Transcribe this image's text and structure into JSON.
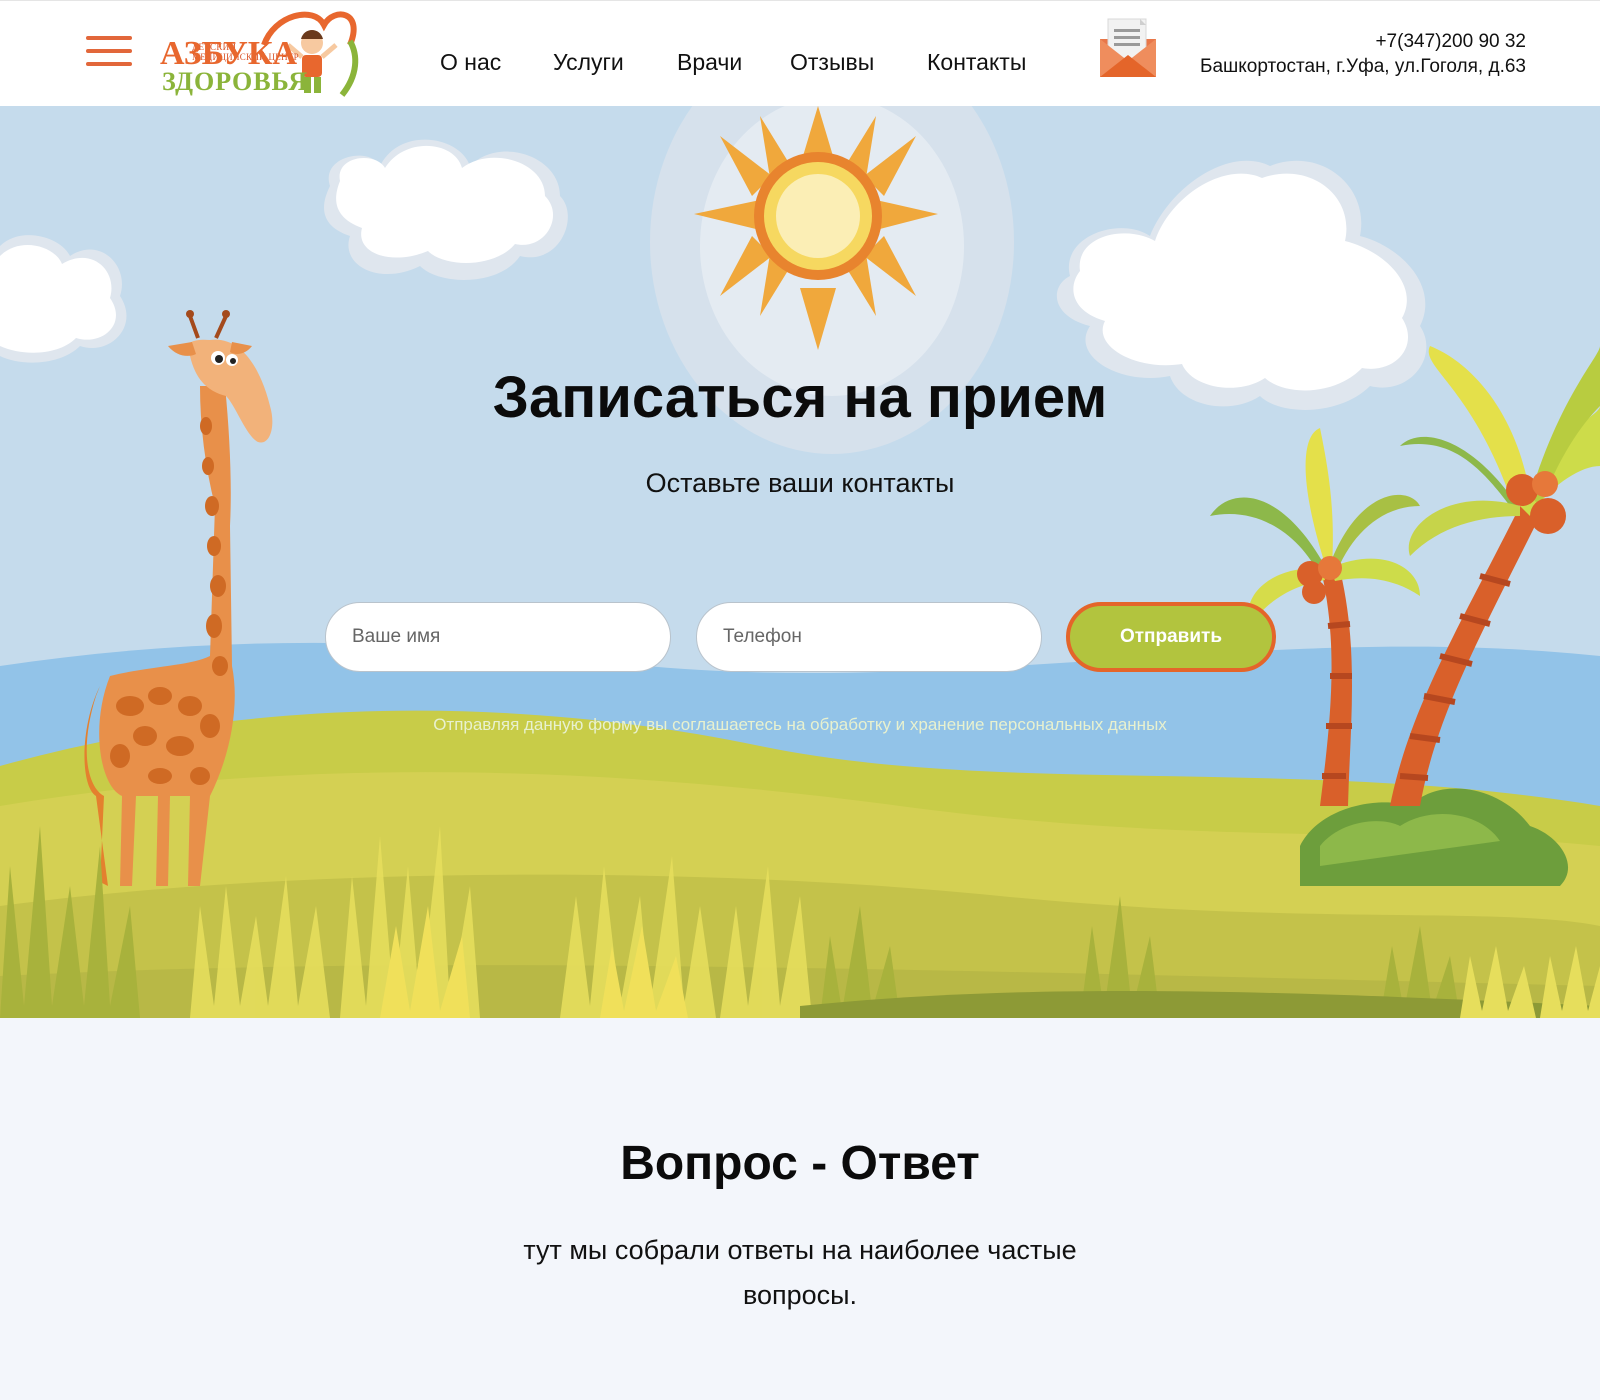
{
  "header": {
    "logo": {
      "line1": "ДЕТСКИЙ",
      "line2": "МЕДИЦИНСКИЙ ЦЕНТР",
      "word1": "АЗБУКА",
      "word2": "ЗДОРОВЬЯ"
    },
    "nav": [
      {
        "label": "О нас"
      },
      {
        "label": "Услуги"
      },
      {
        "label": "Врачи"
      },
      {
        "label": "Отзывы"
      },
      {
        "label": "Контакты"
      }
    ],
    "phone": "+7(347)200 90 32",
    "address": "Башкортостан, г.Уфа, ул.Гоголя, д.63"
  },
  "hero": {
    "title": "Записаться на прием",
    "subtitle": "Оставьте ваши контакты",
    "name_placeholder": "Ваше имя",
    "phone_placeholder": "Телефон",
    "submit_label": "Отправить",
    "consent": "Отправляя данную форму вы соглашаетесь на обработку и хранение персональных данных"
  },
  "faq": {
    "title": "Вопрос - Ответ",
    "subtitle": "тут мы собрали ответы на наиболее частые вопросы."
  },
  "colors": {
    "accent_orange": "#e4652a",
    "accent_green": "#b2c43e",
    "sky": "#c5dbec"
  },
  "icons": [
    "menu-icon",
    "mail-icon"
  ]
}
